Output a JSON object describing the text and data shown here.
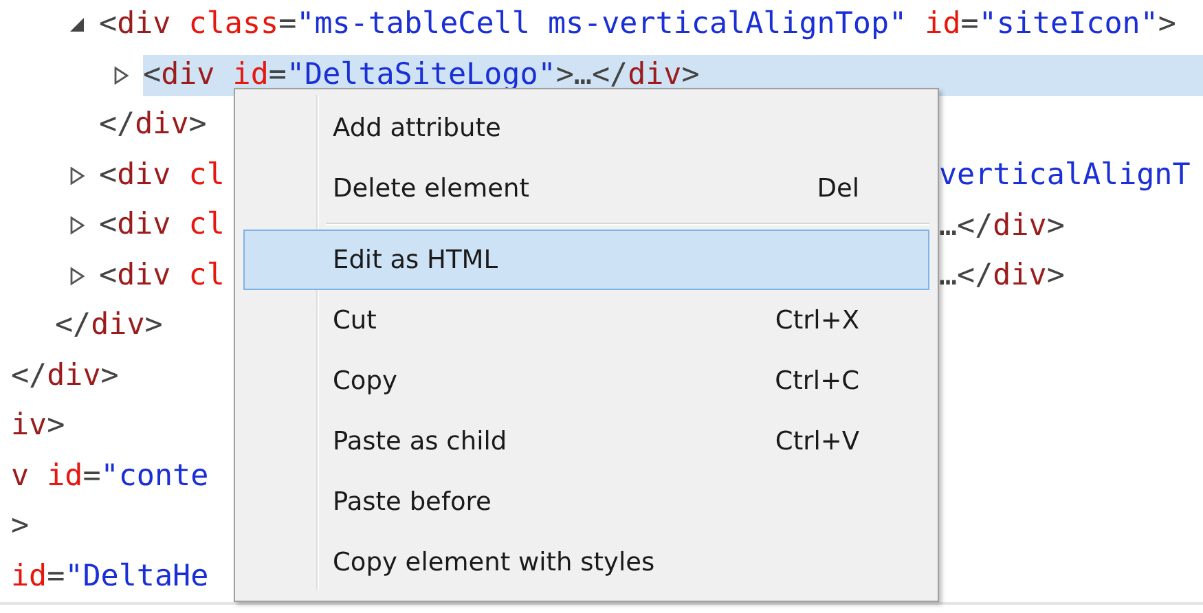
{
  "dom_tree": [
    {
      "children": [
        {
          "children": [
            {
              "expanded": true,
              "selected": false,
              "tokens": [
                {
                  "kind": "punct",
                  "text": "<"
                },
                {
                  "kind": "tag",
                  "text": "div"
                },
                {
                  "kind": "attr",
                  "text": " class"
                },
                {
                  "kind": "punct",
                  "text": "="
                },
                {
                  "kind": "value",
                  "text": "\"ms-tableCell ms-verticalAlignTop\""
                },
                {
                  "kind": "attr",
                  "text": " id"
                },
                {
                  "kind": "punct",
                  "text": "="
                },
                {
                  "kind": "value",
                  "text": "\"siteIcon\""
                },
                {
                  "kind": "punct",
                  "text": ">"
                }
              ],
              "children": [
                {
                  "expanded": false,
                  "selected": true,
                  "tokens": [
                    {
                      "kind": "punct",
                      "text": "<"
                    },
                    {
                      "kind": "tag",
                      "text": "div"
                    },
                    {
                      "kind": "attr",
                      "text": " id"
                    },
                    {
                      "kind": "punct",
                      "text": "="
                    },
                    {
                      "kind": "value",
                      "text": "\"DeltaSiteLogo\""
                    },
                    {
                      "kind": "punct",
                      "text": ">…</"
                    },
                    {
                      "kind": "tag",
                      "text": "div"
                    },
                    {
                      "kind": "punct",
                      "text": ">"
                    }
                  ]
                }
              ]
            },
            {
              "selected": false,
              "tokens": [
                {
                  "kind": "punct",
                  "text": "</"
                },
                {
                  "kind": "tag",
                  "text": "div"
                },
                {
                  "kind": "punct",
                  "text": ">"
                }
              ]
            },
            {
              "expanded": false,
              "selected": false,
              "tokens": [
                {
                  "kind": "punct",
                  "text": "<"
                },
                {
                  "kind": "tag",
                  "text": "div"
                },
                {
                  "kind": "attr",
                  "text": " cl"
                }
              ],
              "tail": [
                {
                  "kind": "value",
                  "text": "verticalAlignT"
                }
              ]
            },
            {
              "expanded": false,
              "selected": false,
              "tokens": [
                {
                  "kind": "punct",
                  "text": "<"
                },
                {
                  "kind": "tag",
                  "text": "div"
                },
                {
                  "kind": "attr",
                  "text": " cl"
                }
              ],
              "tail": [
                {
                  "kind": "punct",
                  "text": "…</"
                },
                {
                  "kind": "tag",
                  "text": "div"
                },
                {
                  "kind": "punct",
                  "text": ">"
                }
              ]
            },
            {
              "expanded": false,
              "selected": false,
              "tokens": [
                {
                  "kind": "punct",
                  "text": "<"
                },
                {
                  "kind": "tag",
                  "text": "div"
                },
                {
                  "kind": "attr",
                  "text": " cl"
                }
              ],
              "tail": [
                {
                  "kind": "punct",
                  "text": "…</"
                },
                {
                  "kind": "tag",
                  "text": "div"
                },
                {
                  "kind": "punct",
                  "text": ">"
                }
              ]
            }
          ]
        },
        {
          "selected": false,
          "tokens": [
            {
              "kind": "punct",
              "text": "</"
            },
            {
              "kind": "tag",
              "text": "div"
            },
            {
              "kind": "punct",
              "text": ">"
            }
          ]
        }
      ]
    },
    {
      "selected": false,
      "tokens": [
        {
          "kind": "punct",
          "text": "</"
        },
        {
          "kind": "tag",
          "text": "div"
        },
        {
          "kind": "punct",
          "text": ">"
        }
      ]
    },
    {
      "selected": false,
      "tokens": [
        {
          "kind": "tag",
          "text": "iv"
        },
        {
          "kind": "punct",
          "text": ">"
        }
      ]
    },
    {
      "selected": false,
      "tokens": [
        {
          "kind": "tag",
          "text": "v"
        },
        {
          "kind": "attr",
          "text": " id"
        },
        {
          "kind": "punct",
          "text": "="
        },
        {
          "kind": "value",
          "text": "\"conte"
        }
      ]
    },
    {
      "selected": false,
      "tokens": [
        {
          "kind": "punct",
          "text": ">"
        }
      ]
    },
    {
      "selected": false,
      "tokens": [
        {
          "kind": "attr",
          "text": "id"
        },
        {
          "kind": "punct",
          "text": "="
        },
        {
          "kind": "value",
          "text": "\"DeltaHe"
        }
      ]
    }
  ],
  "context_menu": [
    {
      "kind": "item",
      "label": "Add attribute",
      "selected": false
    },
    {
      "kind": "item",
      "label": "Delete element",
      "shortcut": "Del",
      "selected": false
    },
    {
      "kind": "separator"
    },
    {
      "kind": "item",
      "label": "Edit as HTML",
      "selected": true
    },
    {
      "kind": "item",
      "label": "Cut",
      "shortcut": "Ctrl+X",
      "selected": false
    },
    {
      "kind": "item",
      "label": "Copy",
      "shortcut": "Ctrl+C",
      "selected": false
    },
    {
      "kind": "item",
      "label": "Paste as child",
      "shortcut": "Ctrl+V",
      "selected": false
    },
    {
      "kind": "item",
      "label": "Paste before",
      "selected": false
    },
    {
      "kind": "item",
      "label": "Copy element with styles",
      "selected": false
    }
  ]
}
